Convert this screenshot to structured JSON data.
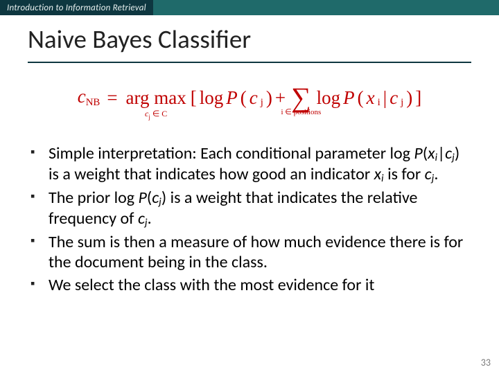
{
  "header": {
    "course": "Introduction to Information Retrieval"
  },
  "title": "Naive Bayes Classifier",
  "formula": {
    "lhs_var": "c",
    "lhs_sub": "NB",
    "eq": "=",
    "argmax": "arg max",
    "argmax_under_pre": "c",
    "argmax_under_set": " ∈ C",
    "lbr": "[",
    "log1": "log ",
    "P": "P",
    "open": "(",
    "c": "c",
    "j": "j",
    "close": ")",
    "plus": " + ",
    "sigma": "∑",
    "sigma_under": "i ∈ positions",
    "log2": "log ",
    "x": "x",
    "i": "i",
    "bar": " | ",
    "rbr": "]"
  },
  "bullets": [
    {
      "pre": "Simple interpretation: Each conditional parameter log ",
      "expr_P": "P",
      "expr_open": "(",
      "expr_x": "x",
      "expr_i": "i",
      "expr_bar": "|",
      "expr_c": "c",
      "expr_j": "j",
      "expr_close": ")",
      "mid": " is a weight that indicates how good an indicator ",
      "xi_x": "x",
      "xi_i": "i",
      "mid2": " is for ",
      "cj_c": "c",
      "cj_j": "j",
      "end": "."
    },
    {
      "pre": "The prior log ",
      "expr_P": "P",
      "expr_open": "(",
      "expr_c": "c",
      "expr_j": "j",
      "expr_close": ")",
      "mid": " is a weight that indicates the relative frequency of ",
      "cj_c": "c",
      "cj_j": "j",
      "end": "."
    },
    {
      "pre": "The sum is then a measure of how much evidence there is for the document being in the class."
    },
    {
      "pre": "We select the class with the most evidence for it"
    }
  ],
  "page_number": "33"
}
